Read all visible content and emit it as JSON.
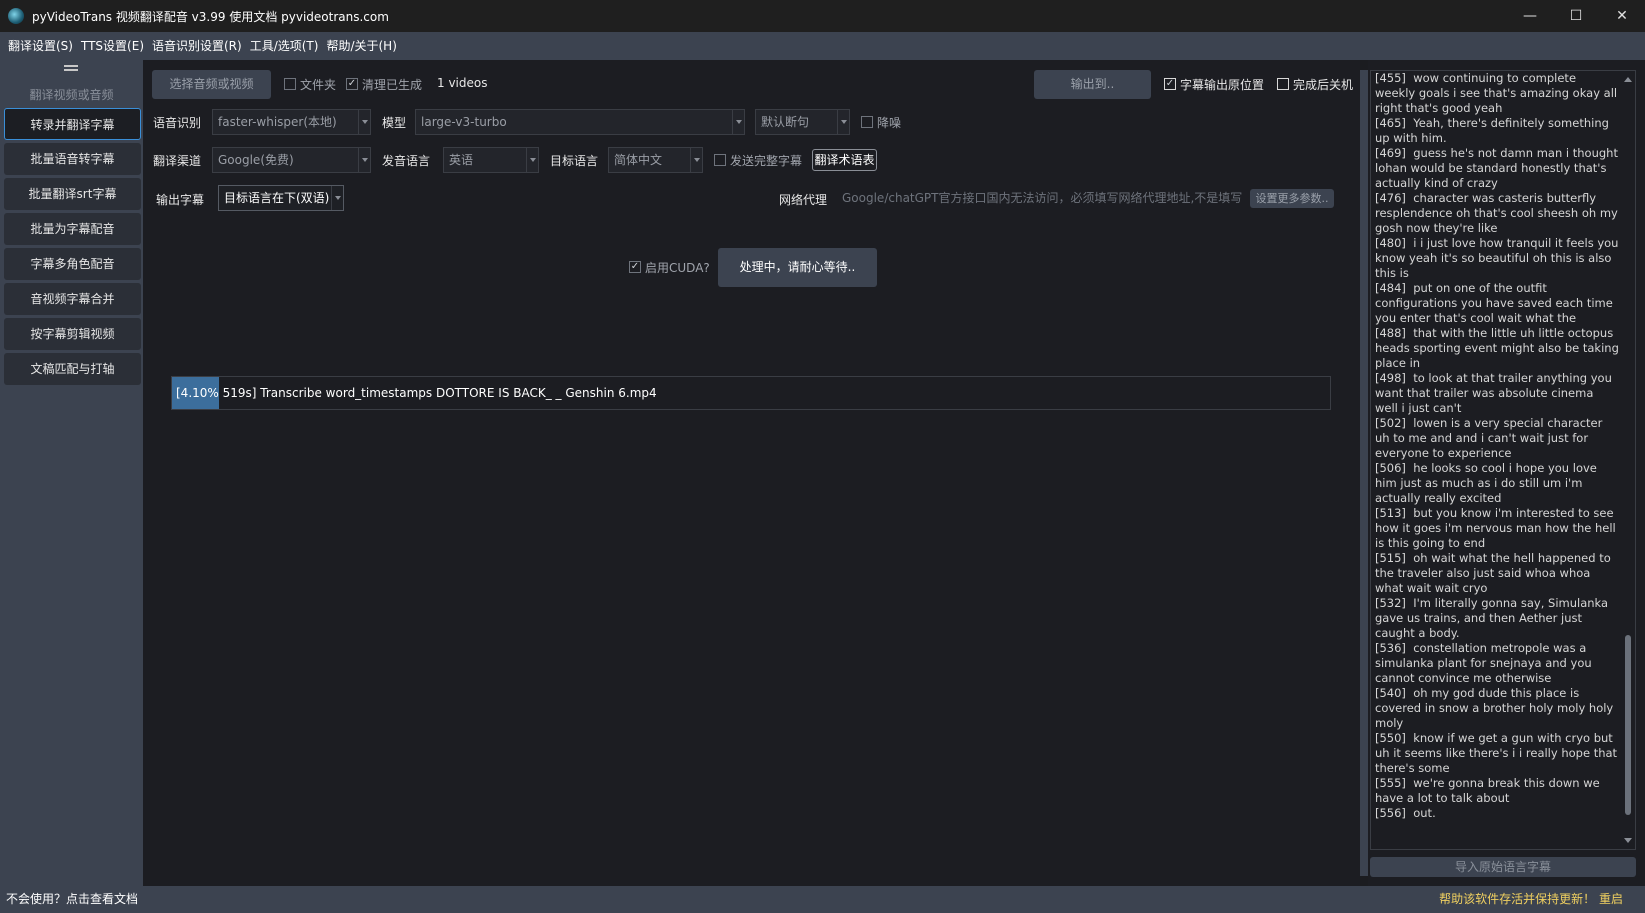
{
  "window": {
    "title": "pyVideoTrans 视频翻译配音 v3.99 使用文档 pyvideotrans.com",
    "minimize": "—",
    "maximize": "☐",
    "close": "✕"
  },
  "menu": [
    "翻译设置(S)",
    "TTS设置(E)",
    "语音识别设置(R)",
    "工具/选项(T)",
    "帮助/关于(H)"
  ],
  "sidebar": {
    "header": "翻译视频或音频",
    "items": [
      "转录并翻译字幕",
      "批量语音转字幕",
      "批量翻译srt字幕",
      "批量为字幕配音",
      "字幕多角色配音",
      "音视频字幕合并",
      "按字幕剪辑视频",
      "文稿匹配与打轴"
    ]
  },
  "toolbar": {
    "select_button": "选择音频或视频",
    "folder_label": "文件夹",
    "clear_label": "清理已生成",
    "video_count": "1 videos",
    "output_button": "输出到..",
    "subtitle_original_label": "字幕输出原位置",
    "shutdown_label": "完成后关机"
  },
  "row_asr": {
    "label": "语音识别",
    "engine": "faster-whisper(本地)",
    "model_label": "模型",
    "model": "large-v3-turbo",
    "split": "默认断句",
    "denoise_label": "降噪"
  },
  "row_translate": {
    "label": "翻译渠道",
    "channel": "Google(免费)",
    "source_label": "发音语言",
    "source": "英语",
    "target_label": "目标语言",
    "target": "简体中文",
    "send_full_label": "发送完整字幕",
    "glossary_button": "翻译术语表"
  },
  "row_output": {
    "label": "输出字幕",
    "mode": "目标语言在下(双语)",
    "proxy_label": "网络代理",
    "proxy_placeholder": "Google/chatGPT官方接口国内无法访问，必须填写网络代理地址,不是填写...",
    "more_button": "设置更多参数.."
  },
  "action": {
    "cuda_label": "启用CUDA?",
    "start_button": "处理中，请耐心等待.."
  },
  "progress": {
    "value": 0.041,
    "percent_label": "[4.10%",
    "text": "519s]  Transcribe word_timestamps DOTTORE IS BACK_  _ Genshin 6.mp4"
  },
  "log": {
    "text": "[455]  wow continuing to complete weekly goals i see that's amazing okay all right that's good yeah\n[465]  Yeah, there's definitely something up with him.\n[469]  guess he's not damn man i thought lohan would be standard honestly that's actually kind of crazy\n[476]  character was casteris butterfly resplendence oh that's cool sheesh oh my gosh now they're like\n[480]  i i just love how tranquil it feels you know yeah it's so beautiful oh this is also this is\n[484]  put on one of the outfit configurations you have saved each time you enter that's cool wait what the\n[488]  that with the little uh little octopus heads sporting event might also be taking place in\n[498]  to look at that trailer anything you want that trailer was absolute cinema well i just can't\n[502]  lowen is a very special character uh to me and and i can't wait just for everyone to experience\n[506]  he looks so cool i hope you love him just as much as i do still um i'm actually really excited\n[513]  but you know i'm interested to see how it goes i'm nervous man how the hell is this going to end\n[515]  oh wait what the hell happened to the traveler also just said whoa whoa what wait wait cryo\n[532]  I'm literally gonna say, Simulanka gave us trains, and then Aether just caught a body.\n[536]  constellation metropole was a simulanka plant for snejnaya and you cannot convince me otherwise\n[540]  oh my god dude this place is covered in snow a brother holy moly holy moly\n[550]  know if we get a gun with cryo but uh it seems like there's i i really hope that there's some\n[555]  we're gonna break this down we have a lot to talk about\n[556]  out.",
    "import_button": "导入原始语言字幕"
  },
  "status": {
    "left": "不会使用？点击查看文档",
    "right": "帮助该软件存活并保持更新！   重启"
  },
  "colors": {
    "accent": "#3a8fd8",
    "progress": "#3c6e9c",
    "panel": "#3c4350",
    "status_highlight": "#f0d060"
  }
}
